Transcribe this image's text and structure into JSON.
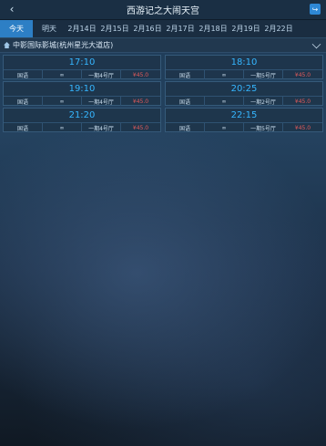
{
  "header": {
    "title": "西游记之大闹天宫",
    "back_icon": "chevron-left-icon",
    "share_icon": "share-icon"
  },
  "dates": [
    "今天",
    "明天",
    "2月14日",
    "2月15日",
    "2月16日",
    "2月17日",
    "2月18日",
    "2月19日",
    "2月22日"
  ],
  "cinema": {
    "name": "中影国际影城(杭州星光大道店)"
  },
  "showtimes": [
    {
      "time": "17:10",
      "language": "国语",
      "format": "∞",
      "hall": "一期4号厅",
      "price": "¥45.0"
    },
    {
      "time": "18:10",
      "language": "国语",
      "format": "∞",
      "hall": "一期5号厅",
      "price": "¥45.0"
    },
    {
      "time": "19:10",
      "language": "国语",
      "format": "∞",
      "hall": "一期4号厅",
      "price": "¥45.0"
    },
    {
      "time": "20:25",
      "language": "国语",
      "format": "∞",
      "hall": "一期2号厅",
      "price": "¥45.0"
    },
    {
      "time": "21:20",
      "language": "国语",
      "format": "∞",
      "hall": "一期4号厅",
      "price": "¥45.0"
    },
    {
      "time": "22:15",
      "language": "国语",
      "format": "∞",
      "hall": "一期5号厅",
      "price": "¥45.0"
    }
  ],
  "colors": {
    "accent": "#2d7fc5",
    "time": "#35b6ff",
    "price": "#e35a5a"
  }
}
